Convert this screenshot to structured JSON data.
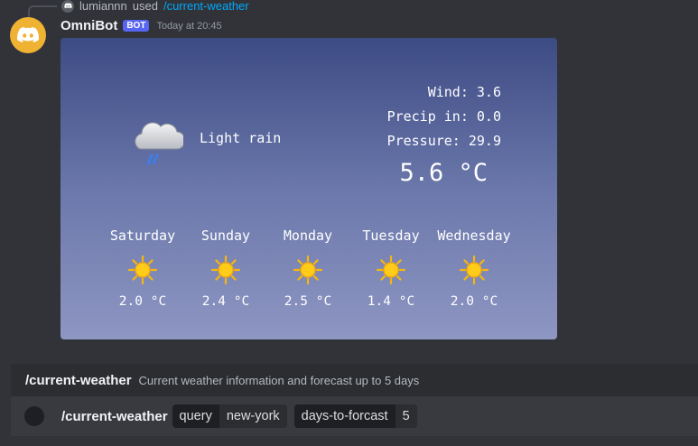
{
  "reply": {
    "username": "lumiannn",
    "verb": "used",
    "command": "/current-weather"
  },
  "message": {
    "author": "OmniBot",
    "badge": "BOT",
    "timestamp": "Today at 20:45"
  },
  "weather": {
    "current": {
      "icon": "cloud-rain-icon",
      "description": "Light rain",
      "wind": "Wind: 3.6",
      "precip": "Precip in: 0.0",
      "pressure": "Pressure: 29.9",
      "temperature": "5.6 °C"
    },
    "forecast": [
      {
        "day": "Saturday",
        "icon": "sun-icon",
        "temp": "2.0 °C"
      },
      {
        "day": "Sunday",
        "icon": "sun-icon",
        "temp": "2.4 °C"
      },
      {
        "day": "Monday",
        "icon": "sun-icon",
        "temp": "2.5 °C"
      },
      {
        "day": "Tuesday",
        "icon": "sun-icon",
        "temp": "1.4 °C"
      },
      {
        "day": "Wednesday",
        "icon": "sun-icon",
        "temp": "2.0 °C"
      }
    ]
  },
  "command_hint": {
    "name": "/current-weather",
    "description": "Current weather information and forecast up to 5 days"
  },
  "input": {
    "command": "/current-weather",
    "options": [
      {
        "name": "query",
        "value": "new-york"
      },
      {
        "name": "days-to-forcast",
        "value": "5"
      }
    ]
  },
  "colors": {
    "background": "#313338",
    "accent": "#5865f2",
    "link": "#00a8fc",
    "avatar": "#f0b232"
  }
}
